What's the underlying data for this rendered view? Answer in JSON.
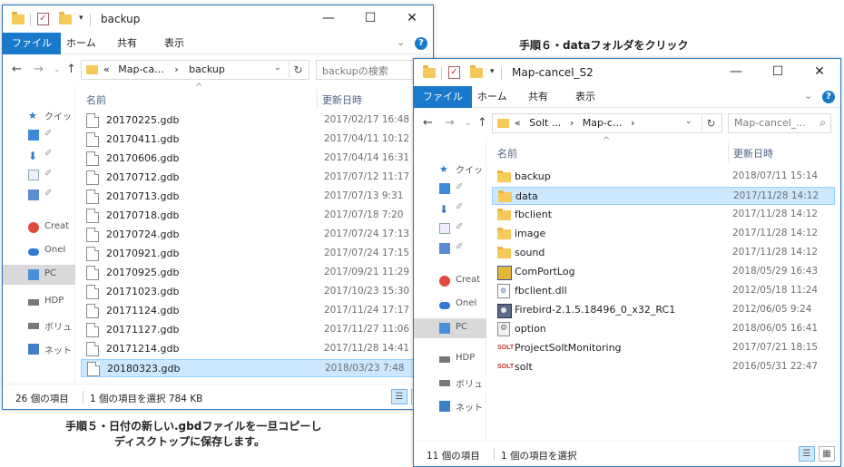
{
  "captions": {
    "step6": "手順６・dataフォルダをクリック",
    "step5_line1": "手順５・日付の新しい.gbdファイルを一旦コピーし",
    "step5_line2": "ディスクトップに保存します。"
  },
  "ribbon_tabs": [
    "ファイル",
    "ホーム",
    "共有",
    "表示"
  ],
  "columns": {
    "name": "名前",
    "date": "更新日時"
  },
  "nav_labels": [
    "クイッ",
    "Creat",
    "OneI",
    "PC",
    "HDP",
    "ボリュ",
    "ネット"
  ],
  "window1": {
    "title": "backup",
    "address_parts": [
      "«",
      "Map-ca...",
      "›",
      "backup"
    ],
    "search_placeholder": "backupの検索",
    "files": [
      {
        "name": "20170225.gdb",
        "date": "2017/02/17 16:48"
      },
      {
        "name": "20170411.gdb",
        "date": "2017/04/11 10:12"
      },
      {
        "name": "20170606.gdb",
        "date": "2017/04/14 16:31"
      },
      {
        "name": "20170712.gdb",
        "date": "2017/07/12 11:17"
      },
      {
        "name": "20170713.gdb",
        "date": "2017/07/13 9:31"
      },
      {
        "name": "20170718.gdb",
        "date": "2017/07/18 7:20"
      },
      {
        "name": "20170724.gdb",
        "date": "2017/07/24 17:13"
      },
      {
        "name": "20170921.gdb",
        "date": "2017/07/24 17:15"
      },
      {
        "name": "20170925.gdb",
        "date": "2017/09/21 11:29"
      },
      {
        "name": "20171023.gdb",
        "date": "2017/10/23 15:30"
      },
      {
        "name": "20171124.gdb",
        "date": "2017/11/24 17:17"
      },
      {
        "name": "20171127.gdb",
        "date": "2017/11/27 11:06"
      },
      {
        "name": "20171214.gdb",
        "date": "2017/11/28 14:41"
      },
      {
        "name": "20180323.gdb",
        "date": "2018/03/23 7:48"
      }
    ],
    "status_count": "26 個の項目",
    "status_selection": "1 個の項目を選択  784 KB"
  },
  "window2": {
    "title": "Map-cancel_S2",
    "address_parts": [
      "«",
      "Solt ...",
      "›",
      "Map-c...",
      "›"
    ],
    "search_placeholder": "Map-cancel_...",
    "files": [
      {
        "name": "backup",
        "date": "2018/07/11 15:14",
        "icon": "folder"
      },
      {
        "name": "data",
        "date": "2017/11/28 14:12",
        "icon": "folder"
      },
      {
        "name": "fbclient",
        "date": "2017/11/28 14:12",
        "icon": "folder"
      },
      {
        "name": "image",
        "date": "2017/11/28 14:12",
        "icon": "folder"
      },
      {
        "name": "sound",
        "date": "2017/11/28 14:12",
        "icon": "folder"
      },
      {
        "name": "ComPortLog",
        "date": "2018/05/29 16:43",
        "icon": "app"
      },
      {
        "name": "fbclient.dll",
        "date": "2012/05/18 11:24",
        "icon": "dll"
      },
      {
        "name": "Firebird-2.1.5.18496_0_x32_RC1",
        "date": "2012/06/05 9:24",
        "icon": "firebird"
      },
      {
        "name": "option",
        "date": "2018/06/05 16:41",
        "icon": "settings"
      },
      {
        "name": "ProjectSoltMonitoring",
        "date": "2017/07/21 18:15",
        "icon": "solt"
      },
      {
        "name": "solt",
        "date": "2016/05/31 22:47",
        "icon": "solt"
      }
    ],
    "status_count": "11 個の項目",
    "status_selection": "1 個の項目を選択"
  },
  "solt_logo_text": "SOLT",
  "colors": {
    "accent": "#1979ca",
    "selection": "#cce8ff",
    "folder": "#f5c95a"
  }
}
